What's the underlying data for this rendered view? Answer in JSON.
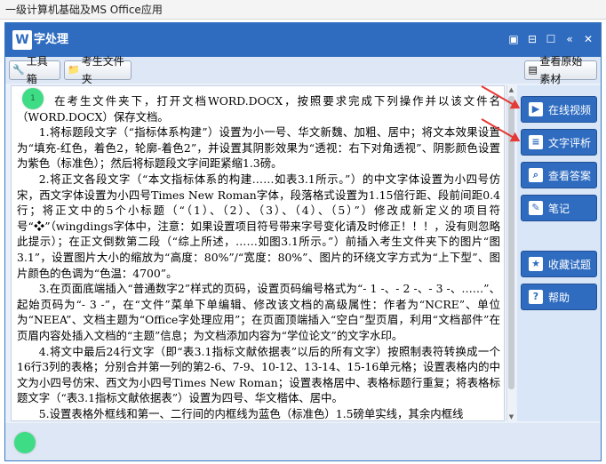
{
  "window": {
    "title": "一级计算机基础及MS Office应用"
  },
  "app": {
    "title": "字处理",
    "logo_letter": "W",
    "window_controls": [
      "restore-icon",
      "minimize-icon",
      "maximize-icon",
      "prev-icon",
      "close-icon"
    ]
  },
  "toolbar": {
    "toolbox_label": "工具箱",
    "student_folder_label": "考生文件夹",
    "view_original_label": "查看原始素材"
  },
  "badges": {
    "top": "1",
    "bottom": ""
  },
  "document": {
    "paragraphs": [
      "在考生文件夹下，打开文档WORD.DOCX，按照要求完成下列操作并以该文件名（WORD.DOCX）保存文档。",
      "1.将标题段文字（“指标体系构建”）设置为小一号、华文新魏、加粗、居中；将文本效果设置为“填充-红色，着色2，轮廓-着色2”，并设置其阴影效果为“透视：右下对角透视”、阴影颜色设置为紫色（标准色）；然后将标题段文字间距紧缩1.3磅。",
      "2.将正文各段文字（“本文指标体系的构建……如表3.1所示。”）的中文字体设置为小四号仿宋，西文字体设置为小四号Times New Roman字体，段落格式设置为1.15倍行距、段前间距0.4行；将正文中的5个小标题（“（1）、（2）、（3）、（4）、（5）”）修改成新定义的项目符号“❖”（wingdings字体中，注意：如果设置项目符号带来字号变化请及时修正！！！，没有则忽略此提示）；在正文倒数第二段（“综上所述，……如图3.1所示。”）前插入考生文件夹下的图片“图3.1”，设置图片大小的缩放为“高度：80%”/“宽度：80%”、图片的环绕文字方式为“上下型”、图片颜色的色调为“色温：4700”。",
      "3.在页面底端插入“普通数字2”样式的页码，设置页码编号格式为“- 1 -、- 2 -、- 3 -、……”、起始页码为“- 3 -”，在“文件”菜单下单编辑、修改该文档的高级属性：作者为“NCRE”、单位为“NEEA”、文档主题为“Office字处理应用”；在页面顶端插入“空白”型页眉，利用“文档部件”在页眉内容处插入文档的“主题”信息；为文档添加内容为“学位论文”的文字水印。",
      "4.将文中最后24行文字（即“表3.1指标文献依据表”以后的所有文字）按照制表符转换成一个16行3列的表格；分别合并第一列的第2-6、7-9、10-12、13-14、15-16单元格；设置表格内的中文为小四号仿宋、西文为小四号Times New Roman；设置表格居中、表格标题行重复；将表格标题文字（“表3.1指标文献依据表”）设置为四号、华文楷体、居中。",
      "5.设置表格外框线和第一、二行间的内框线为蓝色（标准色）1.5磅单实线，其余内框线"
    ]
  },
  "sidebar": {
    "items": [
      {
        "label": "在线视频",
        "icon": "video-icon"
      },
      {
        "label": "文字评析",
        "icon": "document-icon"
      },
      {
        "label": "查看答案",
        "icon": "search-icon"
      },
      {
        "label": "笔记",
        "icon": "notes-icon"
      },
      {
        "label": "收藏试题",
        "icon": "star-icon"
      },
      {
        "label": "帮助",
        "icon": "help-icon"
      }
    ]
  },
  "colors": {
    "primary": "#2f6cc0",
    "badge": "#3fdc86",
    "arrow": "#e53935"
  }
}
